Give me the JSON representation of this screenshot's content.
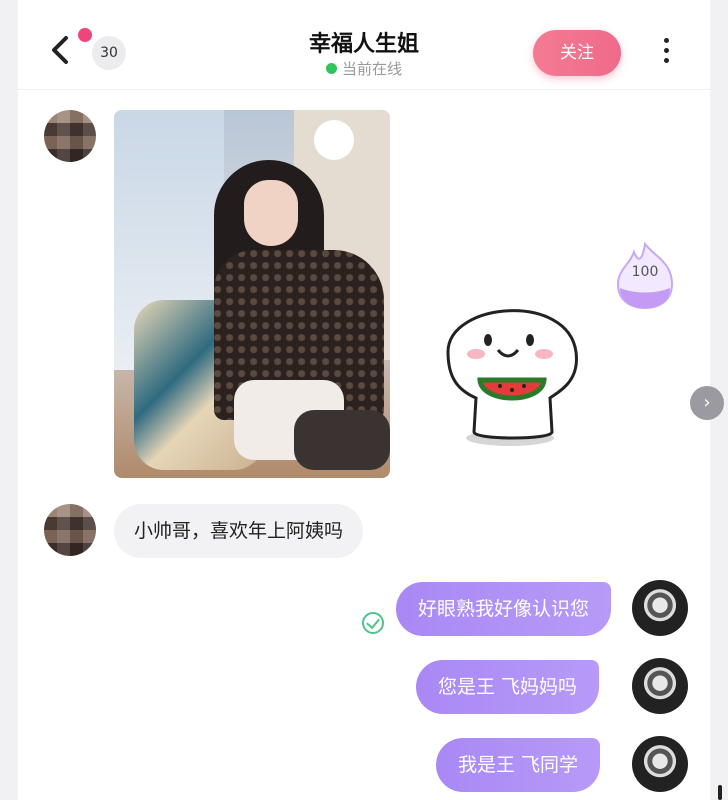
{
  "header": {
    "back_icon": "chevron-left-icon",
    "unread_count": "30",
    "title": "幸福人生姐",
    "status": "当前在线",
    "follow_label": "关注",
    "more_icon": "more-vertical-icon"
  },
  "messages": {
    "photo": "woman-sitting-photo",
    "sticker": "watermelon-eating-sticker",
    "hot_badge_value": "100",
    "incoming_text": "小帅哥，喜欢年上阿姨吗",
    "outgoing": [
      "好眼熟我好像认识您",
      "您是王 飞妈妈吗",
      "我是王 飞同学"
    ]
  },
  "colors": {
    "accent_pink": "#ef6a8a",
    "outgoing_bubble": "#b19af6",
    "online_green": "#33c35c"
  }
}
